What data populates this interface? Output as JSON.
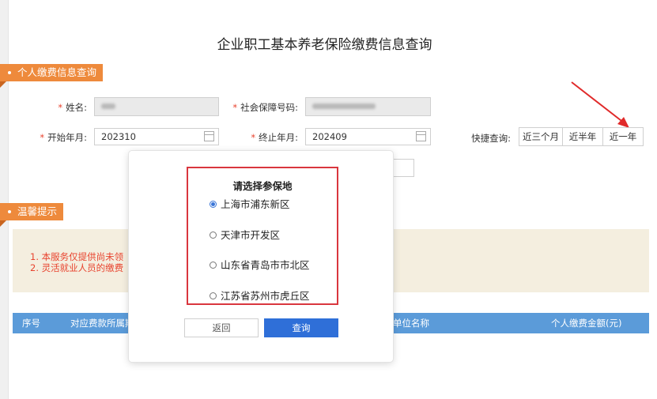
{
  "page": {
    "title": "企业职工基本养老保险缴费信息查询",
    "section_personal": "个人缴费信息查询",
    "section_tips": "温馨提示"
  },
  "form": {
    "name_label": "姓名:",
    "ssn_label": "社会保障号码:",
    "start_label": "开始年月:",
    "start_value": "202310",
    "end_label": "终止年月:",
    "end_value": "202409",
    "quick_label": "快捷查询:",
    "quick_options": [
      "近三个月",
      "近半年",
      "近一年"
    ],
    "required_mark": "*"
  },
  "notice": {
    "line1": "1. 本服务仅提供尚未领",
    "line2": "2. 灵活就业人员的缴费"
  },
  "table": {
    "columns": [
      "序号",
      "对应费款所属期",
      "单位名称",
      "个人缴费金额(元)"
    ]
  },
  "dialog": {
    "title": "请选择参保地",
    "options": [
      "上海市浦东新区",
      "天津市开发区",
      "山东省青岛市市北区",
      "江苏省苏州市虎丘区"
    ],
    "selected_index": 0,
    "back_label": "返回",
    "query_label": "查询"
  },
  "colors": {
    "accent_orange": "#ee8a3c",
    "table_header_blue": "#5b9bd9",
    "primary_button": "#2f6fd8",
    "highlight_red": "#d9363e"
  }
}
